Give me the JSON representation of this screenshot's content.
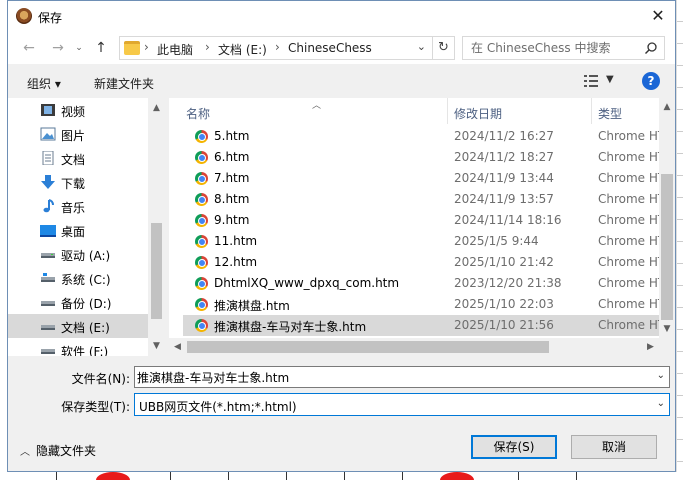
{
  "dialog": {
    "title": "保存",
    "close": "✕"
  },
  "nav": {
    "back": "←",
    "forward": "→",
    "up": "↑",
    "breadcrumb": [
      "此电脑",
      "文档 (E:)",
      "ChineseChess"
    ],
    "separator": "›",
    "search_placeholder": "在 ChineseChess 中搜索"
  },
  "toolbar": {
    "organize": "组织 ▾",
    "new_folder": "新建文件夹",
    "help": "?"
  },
  "sidebar": {
    "items": [
      {
        "label": "视频",
        "icon": "video-icon"
      },
      {
        "label": "图片",
        "icon": "picture-icon"
      },
      {
        "label": "文档",
        "icon": "document-icon"
      },
      {
        "label": "下载",
        "icon": "download-icon"
      },
      {
        "label": "音乐",
        "icon": "music-icon"
      },
      {
        "label": "桌面",
        "icon": "desktop-icon"
      },
      {
        "label": "驱动 (A:)",
        "icon": "drive-icon"
      },
      {
        "label": "系统 (C:)",
        "icon": "drive-icon"
      },
      {
        "label": "备份 (D:)",
        "icon": "drive-icon"
      },
      {
        "label": "文档 (E:)",
        "icon": "drive-icon",
        "selected": true
      },
      {
        "label": "软件 (F:)",
        "icon": "drive-icon"
      }
    ]
  },
  "filelist": {
    "columns": {
      "name": "名称",
      "date": "修改日期",
      "type": "类型"
    },
    "rows": [
      {
        "name": "5.htm",
        "date": "2024/11/2 16:27",
        "type": "Chrome HTI"
      },
      {
        "name": "6.htm",
        "date": "2024/11/2 18:27",
        "type": "Chrome HTI"
      },
      {
        "name": "7.htm",
        "date": "2024/11/9 13:44",
        "type": "Chrome HTI"
      },
      {
        "name": "8.htm",
        "date": "2024/11/9 13:57",
        "type": "Chrome HTI"
      },
      {
        "name": "9.htm",
        "date": "2024/11/14 18:16",
        "type": "Chrome HTI"
      },
      {
        "name": "11.htm",
        "date": "2025/1/5 9:44",
        "type": "Chrome HTI"
      },
      {
        "name": "12.htm",
        "date": "2025/1/10 21:42",
        "type": "Chrome HTI"
      },
      {
        "name": "DhtmlXQ_www_dpxq_com.htm",
        "date": "2023/12/20 21:38",
        "type": "Chrome HTI"
      },
      {
        "name": "推演棋盘.htm",
        "date": "2025/1/10 22:03",
        "type": "Chrome HTI"
      },
      {
        "name": "推演棋盘-车马对车士象.htm",
        "date": "2025/1/10 21:56",
        "type": "Chrome HTI",
        "selected": true
      }
    ]
  },
  "form": {
    "filename_label": "文件名(N):",
    "filename_value": "推演棋盘-车马对车士象.htm",
    "filetype_label": "保存类型(T):",
    "filetype_value": "UBB网页文件(*.htm;*.html)"
  },
  "footer": {
    "hide_folders": "隐藏文件夹",
    "save": "保存(S)",
    "cancel": "取消"
  },
  "colors": {
    "accent": "#0078d7",
    "selected_bg": "#d9d9d9",
    "help_bg": "#1a66d6"
  }
}
